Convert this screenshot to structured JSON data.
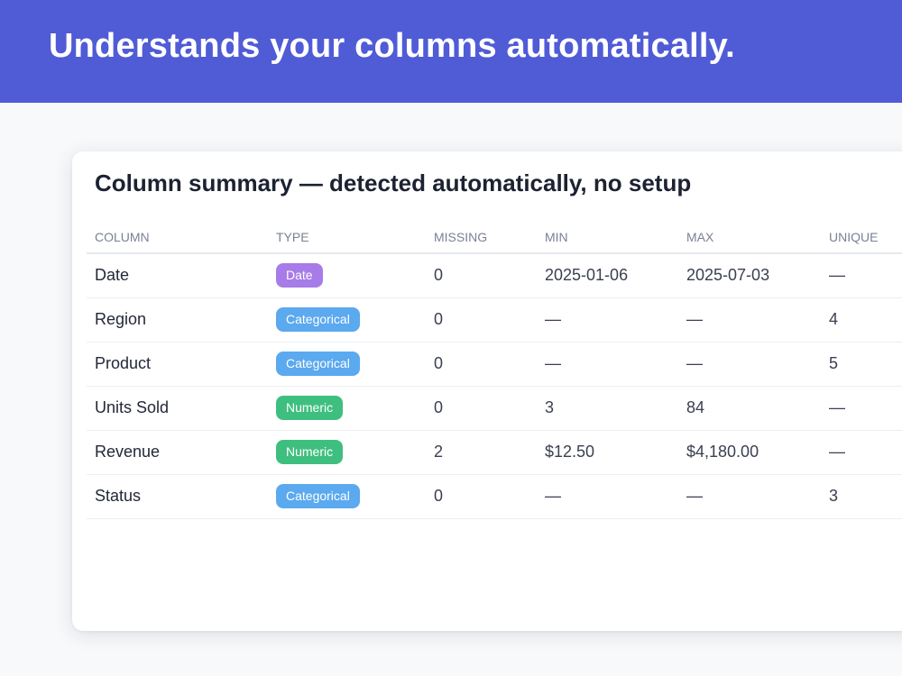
{
  "hero": {
    "title": "Understands your columns automatically."
  },
  "card": {
    "title": "Column summary — detected automatically, no setup"
  },
  "columns": [
    "COLUMN",
    "TYPE",
    "MISSING",
    "MIN",
    "MAX",
    "UNIQUE"
  ],
  "type_colors": {
    "Date": "#a77be8",
    "Categorical": "#5ba9ee",
    "Numeric": "#3fbf7f"
  },
  "rows": [
    {
      "column": "Date",
      "type": "Date",
      "missing": "0",
      "min": "2025-01-06",
      "max": "2025-07-03",
      "unique": "—"
    },
    {
      "column": "Region",
      "type": "Categorical",
      "missing": "0",
      "min": "—",
      "max": "—",
      "unique": "4"
    },
    {
      "column": "Product",
      "type": "Categorical",
      "missing": "0",
      "min": "—",
      "max": "—",
      "unique": "5"
    },
    {
      "column": "Units Sold",
      "type": "Numeric",
      "missing": "0",
      "min": "3",
      "max": "84",
      "unique": "—"
    },
    {
      "column": "Revenue",
      "type": "Numeric",
      "missing": "2",
      "min": "$12.50",
      "max": "$4,180.00",
      "unique": "—"
    },
    {
      "column": "Status",
      "type": "Categorical",
      "missing": "0",
      "min": "—",
      "max": "—",
      "unique": "3"
    }
  ]
}
